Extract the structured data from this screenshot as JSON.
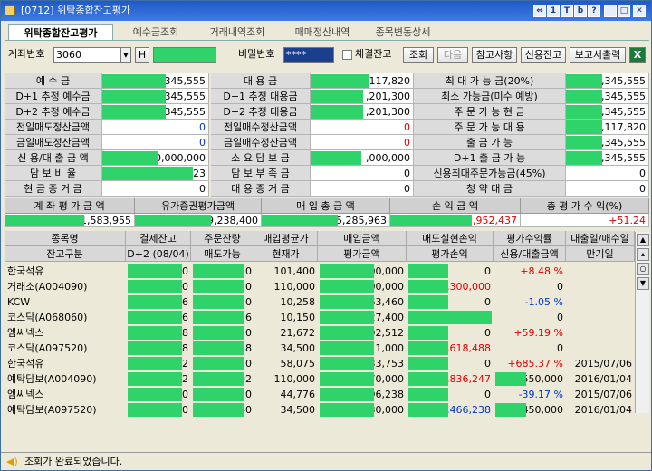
{
  "title": "[0712] 위탁종합잔고평가",
  "titlebar_buttons": [
    "⇔",
    "1",
    "T",
    "b",
    "?",
    "_",
    "□",
    "✕"
  ],
  "tabs": [
    "위탁종합잔고평가",
    "예수금조회",
    "거래내역조회",
    "매매정산내역",
    "종목변동상세"
  ],
  "controls": {
    "account_label": "계좌번호",
    "account_value": "3060",
    "h_button": "H",
    "password_label": "비밀번호",
    "password_value": "****",
    "checkbox_label": "체결잔고",
    "query": "조회",
    "next": "다음",
    "ref": "참고사항",
    "credit": "신용잔고",
    "report": "보고서출력"
  },
  "summary_left": [
    {
      "label": "예    수    금",
      "value": ",345,555"
    },
    {
      "label": "D+1 추정 예수금",
      "value": ",345,555"
    },
    {
      "label": "D+2 추정 예수금",
      "value": ",345,555"
    },
    {
      "label": "전일매도정산금액",
      "value": "0"
    },
    {
      "label": "금일매도정산금액",
      "value": "0"
    },
    {
      "label": "신 용/대 출 금 액",
      "value": "0,000,000"
    },
    {
      "label": "담  보  비  율",
      "value": "23"
    },
    {
      "label": "현  금  증  거  금",
      "value": "0"
    }
  ],
  "summary_mid": [
    {
      "label": "대     용     금",
      "value": ",117,820"
    },
    {
      "label": "D+1 추정 대용금",
      "value": ",201,300"
    },
    {
      "label": "D+2 추정 대용금",
      "value": ",201,300"
    },
    {
      "label": "전일매수정산금액",
      "value": "0"
    },
    {
      "label": "금일매수정산금액",
      "value": "0"
    },
    {
      "label": "소  요  담  보  금",
      "value": ",000,000"
    },
    {
      "label": "담  보  부  족  금",
      "value": "0"
    },
    {
      "label": "대  용  증  거  금",
      "value": "0"
    }
  ],
  "summary_right": [
    {
      "label": "최 대 가 능 금(20%)",
      "value": ",345,555"
    },
    {
      "label": "최소 가능금(미수 예방)",
      "value": ",345,555"
    },
    {
      "label": "주  문  가  능  현  금",
      "value": ",345,555"
    },
    {
      "label": "주  문  가  능  대  용",
      "value": ",117,820"
    },
    {
      "label": "출    금    가    능",
      "value": ",345,555"
    },
    {
      "label": "D+1  출  금  가  능",
      "value": ",345,555"
    },
    {
      "label": "신용최대주문가능금(45%)",
      "value": "0"
    },
    {
      "label": "청        약        대        금",
      "value": "0"
    }
  ],
  "totals": {
    "headers": [
      "계 좌 평 가 금 액",
      "유가증권평가금액",
      "매  입  총  금  액",
      "손  익  금  액",
      "총  평  가  수  익(%)"
    ],
    "values": [
      "1,583,955",
      "9,238,400",
      "5,285,963",
      "3,952,437",
      "+51.24"
    ]
  },
  "table_headers_top": [
    "종목명",
    "결제잔고",
    "주문잔량",
    "매입평균가",
    "매입금액",
    "매도실현손익",
    "평가수익률",
    "대출일/매수일"
  ],
  "table_headers_bottom": [
    "잔고구분",
    "D+2 (08/04)",
    "매도가능",
    "현재가",
    "평가금액",
    "평가손익",
    "신용/대출금액",
    "만기일"
  ],
  "rows": [
    {
      "name": "한국석유",
      "c1": "00",
      "c2": "0",
      "c3": "101,400",
      "c4": ",700,000",
      "c5": "0",
      "c6": "+8.48 %",
      "c7": ""
    },
    {
      "name": "거래소(A004090)",
      "c1": "00",
      "c2": "0",
      "c3": "110,000",
      "c4": ",000,000",
      "c5": ",300,000",
      "c6": "0",
      "c7": ""
    },
    {
      "name": "KCW",
      "c1": "16",
      "c2": "0",
      "c3": "10,258",
      "c4": ",963,460",
      "c5": "0",
      "c6": "-1.05 %",
      "c7": ""
    },
    {
      "name": "코스닥(A068060)",
      "c1": "16",
      "c2": "16",
      "c3": "10,150",
      "c4": ",627,400",
      "c5": "",
      "c6": "0",
      "c7": ""
    },
    {
      "name": "엠씨넥스",
      "c1": "38",
      "c2": "0",
      "c3": "21,672",
      "c4": ",492,512",
      "c5": "0",
      "c6": "+59.19 %",
      "c7": ""
    },
    {
      "name": "코스닥(A097520)",
      "c1": "38",
      "c2": "38",
      "c3": "34,500",
      "c4": ",111,000",
      "c5": ",618,488",
      "c6": "0",
      "c7": ""
    },
    {
      "name": "한국석유",
      "c1": "02",
      "c2": "0",
      "c3": "58,075",
      "c4": ",833,753",
      "c5": "0",
      "c6": "+685.37 %",
      "c7": "2015/07/06"
    },
    {
      "name": "예탁담보(A004090)",
      "c1": "02",
      "c2": "02",
      "c3": "110,000",
      "c4": ",670,000",
      "c5": ",836,247",
      "c6": ",550,000",
      "c7": "2016/01/04"
    },
    {
      "name": "엠씨넥스",
      "c1": "40",
      "c2": "0",
      "c3": "44,776",
      "c4": ",296,238",
      "c5": "0",
      "c6": "-39.17 %",
      "c7": "2015/07/06"
    },
    {
      "name": "예탁담보(A097520)",
      "c1": "40",
      "c2": "40",
      "c3": "34,500",
      "c4": ",830,000",
      "c5": ",466,238",
      "c6": ",450,000",
      "c7": "2016/01/04"
    }
  ],
  "status": "조회가 완료되었습니다."
}
